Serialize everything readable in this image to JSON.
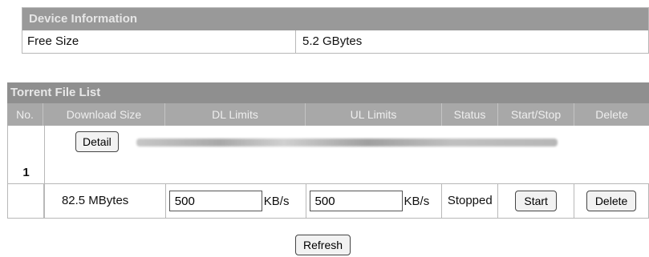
{
  "device_info": {
    "title": "Device Information",
    "rows": [
      {
        "label": "Free Size",
        "value": "5.2 GBytes"
      }
    ]
  },
  "torrent_list": {
    "title": "Torrent File List",
    "headers": {
      "no": "No.",
      "download_size": "Download Size",
      "dl_limits": "DL Limits",
      "ul_limits": "UL Limits",
      "status": "Status",
      "start_stop": "Start/Stop",
      "delete": "Delete"
    },
    "rows": [
      {
        "no": "1",
        "detail_label": "Detail",
        "download_size": "82.5 MBytes",
        "dl_limit": "500",
        "dl_unit": "KB/s",
        "ul_limit": "500",
        "ul_unit": "KB/s",
        "status": "Stopped",
        "start_label": "Start",
        "delete_label": "Delete"
      }
    ]
  },
  "refresh_label": "Refresh"
}
